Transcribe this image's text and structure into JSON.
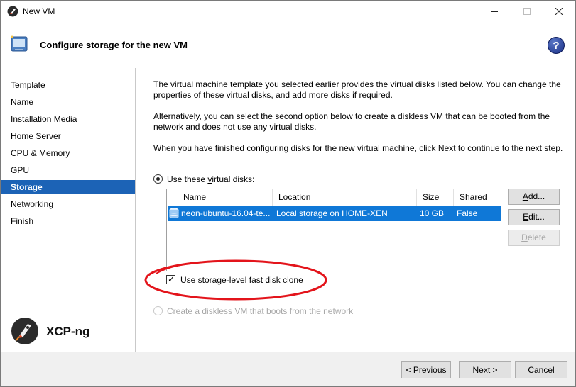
{
  "window": {
    "title": "New VM",
    "title_icon": "xcp-ng-icon",
    "controls": [
      "minimize",
      "maximize",
      "close"
    ]
  },
  "header": {
    "title": "Configure storage for the new VM",
    "icon": "wizard-icon",
    "help_label": "?"
  },
  "sidebar": {
    "items": [
      {
        "label": "Template",
        "active": false
      },
      {
        "label": "Name",
        "active": false
      },
      {
        "label": "Installation Media",
        "active": false
      },
      {
        "label": "Home Server",
        "active": false
      },
      {
        "label": "CPU & Memory",
        "active": false
      },
      {
        "label": "GPU",
        "active": false
      },
      {
        "label": "Storage",
        "active": true
      },
      {
        "label": "Networking",
        "active": false
      },
      {
        "label": "Finish",
        "active": false
      }
    ],
    "brand": "XCP-ng"
  },
  "main": {
    "intro_1": "The virtual machine template you selected earlier provides the virtual disks listed below. You can change the properties of these virtual disks, and add more disks if required.",
    "intro_2": "Alternatively, you can select the second option below to create a diskless VM that can be booted from the network and does not use any virtual disks.",
    "intro_3": "When you have finished configuring disks for the new virtual machine, click Next to continue to the next step.",
    "option_disks": {
      "label_pre": "Use these ",
      "label_key": "v",
      "label_post": "irtual disks:",
      "selected": true
    },
    "table": {
      "columns": [
        "Name",
        "Location",
        "Size",
        "Shared"
      ],
      "rows": [
        {
          "name": "neon-ubuntu-16.04-te...",
          "location": "Local storage on HOME-XEN",
          "size": "10 GB",
          "shared": "False",
          "selected": true
        }
      ]
    },
    "buttons": {
      "add": {
        "key": "A",
        "rest": "dd..."
      },
      "edit": {
        "key": "E",
        "rest": "dit..."
      },
      "delete": {
        "key": "D",
        "rest": "elete"
      }
    },
    "fast_clone": {
      "label_pre": "Use storage-level ",
      "label_key": "f",
      "label_post": "ast disk clone",
      "checked": true
    },
    "option_diskless": {
      "label": "Create a diskless VM that boots from the network",
      "selected": false,
      "enabled": false
    }
  },
  "footer": {
    "previous": {
      "pre": "< ",
      "key": "P",
      "post": "revious"
    },
    "next": {
      "key": "N",
      "post": "ext >"
    },
    "cancel": "Cancel"
  },
  "colors": {
    "selection": "#0f78d7",
    "sidebar_active": "#1c63b6",
    "annotation": "#e3141b"
  }
}
